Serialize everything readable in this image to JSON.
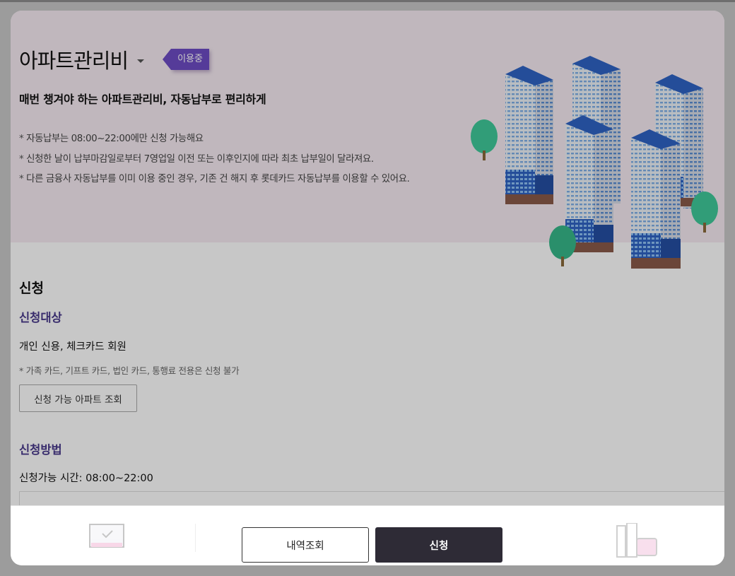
{
  "header": {
    "title": "아파트관리비",
    "status_badge": "이용중",
    "subtitle": "매번 챙겨야 하는 아파트관리비, 자동납부로 편리하게",
    "notes": [
      "자동납부는 08:00~22:00에만 신청 가능해요",
      "신청한 날이 납부마감일로부터 7영업일 이전 또는 이후인지에 따라 최초 납부일이 달라져요.",
      "다른 금융사 자동납부를 이미 이용 중인 경우, 기존 건 해지 후 롯데카드 자동납부를 이용할 수 있어요."
    ]
  },
  "section": {
    "title": "신청",
    "target_heading": "신청대상",
    "target_text": "개인 신용, 체크카드 회원",
    "target_note": "가족 카드, 기프트 카드, 법인 카드, 통행료 전용은 신청 불가",
    "apt_lookup_button": "신청 가능 아파트 조회",
    "method_heading": "신청방법",
    "time_text": "신청가능 시간: 08:00~22:00"
  },
  "footer": {
    "history_button": "내역조회",
    "apply_button": "신청"
  },
  "colors": {
    "accent": "#6e4cc4",
    "heading_purple": "#4a3a8c",
    "hero_bg": "#f6ebf2",
    "apply_bg": "#2e2b36"
  }
}
